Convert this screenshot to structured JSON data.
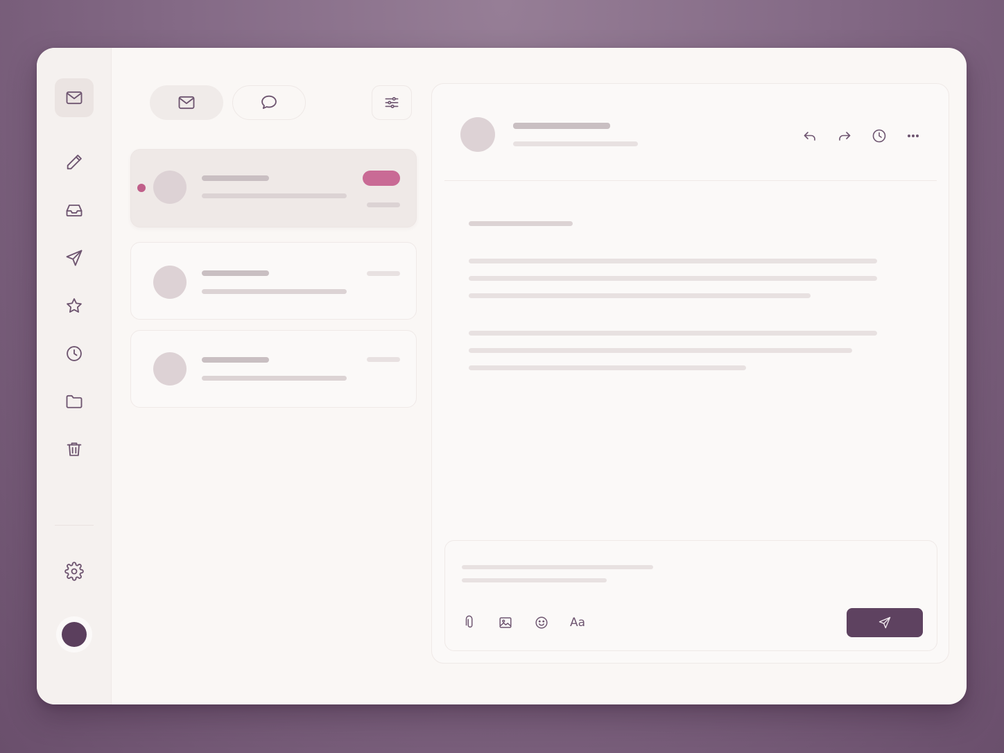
{
  "app": {
    "accent_color": "#c96a95",
    "primary_button_color": "#5e4260",
    "background_color": "#846a86"
  },
  "sidebar": {
    "items": [
      {
        "id": "mail",
        "icon": "mail-icon",
        "active": true
      },
      {
        "id": "compose",
        "icon": "pencil-icon",
        "active": false
      },
      {
        "id": "inbox",
        "icon": "inbox-tray-icon",
        "active": false
      },
      {
        "id": "sent",
        "icon": "paper-plane-icon",
        "active": false
      },
      {
        "id": "starred",
        "icon": "star-icon",
        "active": false
      },
      {
        "id": "snoozed",
        "icon": "clock-icon",
        "active": false
      },
      {
        "id": "folders",
        "icon": "folder-icon",
        "active": false
      },
      {
        "id": "trash",
        "icon": "trash-icon",
        "active": false
      }
    ],
    "settings_icon": "gear-icon",
    "avatar_color": "#5b3f5d"
  },
  "list_toolbar": {
    "segments": [
      {
        "id": "mail",
        "icon": "mail-icon",
        "selected": true
      },
      {
        "id": "chat",
        "icon": "chat-bubble-icon",
        "selected": false
      }
    ],
    "filter_icon": "sliders-icon"
  },
  "mail_list": {
    "items": [
      {
        "selected": true,
        "unread": true,
        "has_tag": true
      },
      {
        "selected": false,
        "unread": false,
        "has_tag": false
      },
      {
        "selected": false,
        "unread": false,
        "has_tag": false
      }
    ]
  },
  "reader": {
    "actions": [
      {
        "id": "reply",
        "icon": "reply-icon"
      },
      {
        "id": "forward",
        "icon": "forward-icon"
      },
      {
        "id": "snooze",
        "icon": "clock-icon"
      },
      {
        "id": "more",
        "icon": "more-horizontal-icon"
      }
    ]
  },
  "composer": {
    "tools": [
      {
        "id": "attach",
        "icon": "paperclip-icon"
      },
      {
        "id": "image",
        "icon": "image-icon"
      },
      {
        "id": "emoji",
        "icon": "smiley-icon"
      },
      {
        "id": "format",
        "label": "Aa"
      }
    ],
    "send_icon": "send-icon"
  }
}
